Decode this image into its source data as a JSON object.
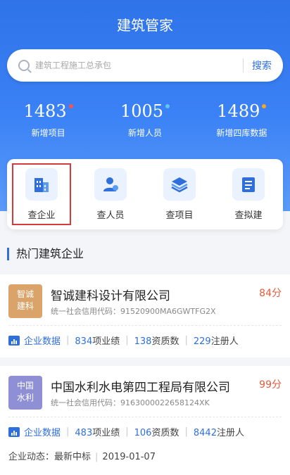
{
  "app": {
    "title": "建筑管家"
  },
  "search": {
    "placeholder": "建筑工程施工总承包",
    "button_label": "搜索"
  },
  "stats": [
    {
      "value": "1483",
      "label": "新增项目",
      "dot_color": "#f2554f"
    },
    {
      "value": "1005",
      "label": "新增人员",
      "dot_color": "#5fc7f0"
    },
    {
      "value": "1489",
      "label": "新增四库数据",
      "dot_color": "#f5a623"
    }
  ],
  "quick": [
    {
      "label": "查企业",
      "icon": "building-icon",
      "selected": true
    },
    {
      "label": "查人员",
      "icon": "person-icon",
      "selected": false
    },
    {
      "label": "查项目",
      "icon": "layers-icon",
      "selected": false
    },
    {
      "label": "查拟建",
      "icon": "document-icon",
      "selected": false
    }
  ],
  "section": {
    "title": "热门建筑企业"
  },
  "companies": [
    {
      "logo_line1": "智诚",
      "logo_line2": "建科",
      "logo_color": "#d9a36a",
      "name": "智诚建科设计有限公司",
      "score": "84分",
      "code_label": "统一社会信用代码：",
      "code": "91520900MA6GWTFG2X",
      "data_label": "企业数据",
      "performance_count": "834",
      "performance_label": "项业绩",
      "qualification_count": "138",
      "qualification_label": "资质数",
      "registered_count": "229",
      "registered_label": "注册人"
    },
    {
      "logo_line1": "中国",
      "logo_line2": "水利",
      "logo_color": "#8f8fd6",
      "name": "中国水利水电第四工程局有限公司",
      "score": "99分",
      "code_label": "统一社会信用代码：",
      "code": "9163000022658124XK",
      "data_label": "企业数据",
      "performance_count": "483",
      "performance_label": "项业绩",
      "qualification_count": "106",
      "qualification_label": "资质数",
      "registered_count": "8442",
      "registered_label": "注册人"
    }
  ],
  "dynamic": {
    "label": "企业动态：",
    "status": "最新中标",
    "date": "2019-01-07"
  }
}
